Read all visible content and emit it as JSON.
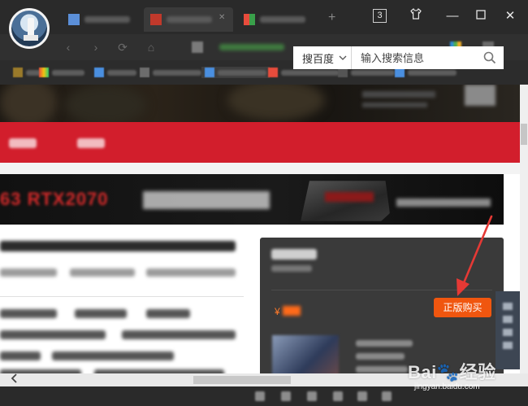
{
  "browser": {
    "tab_count": "3",
    "tabs": [
      {
        "label": ""
      },
      {
        "label": ""
      },
      {
        "label": ""
      }
    ],
    "new_tab_symbol": "+",
    "window_controls": {
      "skin": "👕",
      "minimize": "—",
      "maximize": "☐",
      "close": "✕"
    }
  },
  "site": {
    "search": {
      "dropdown_label": "搜百度",
      "placeholder": "输入搜索信息"
    },
    "banner": {
      "headline": "63 RTX2070"
    },
    "sidecard": {
      "currency_symbol": "¥",
      "buy_button_label": "正版购买"
    }
  },
  "colors": {
    "nav_red": "#d21e2c",
    "buy_orange": "#f0560f",
    "annotation_red": "#e53935"
  },
  "watermark": {
    "brand": "Bai🐾经验",
    "url": "jingyan.baidu.com"
  }
}
